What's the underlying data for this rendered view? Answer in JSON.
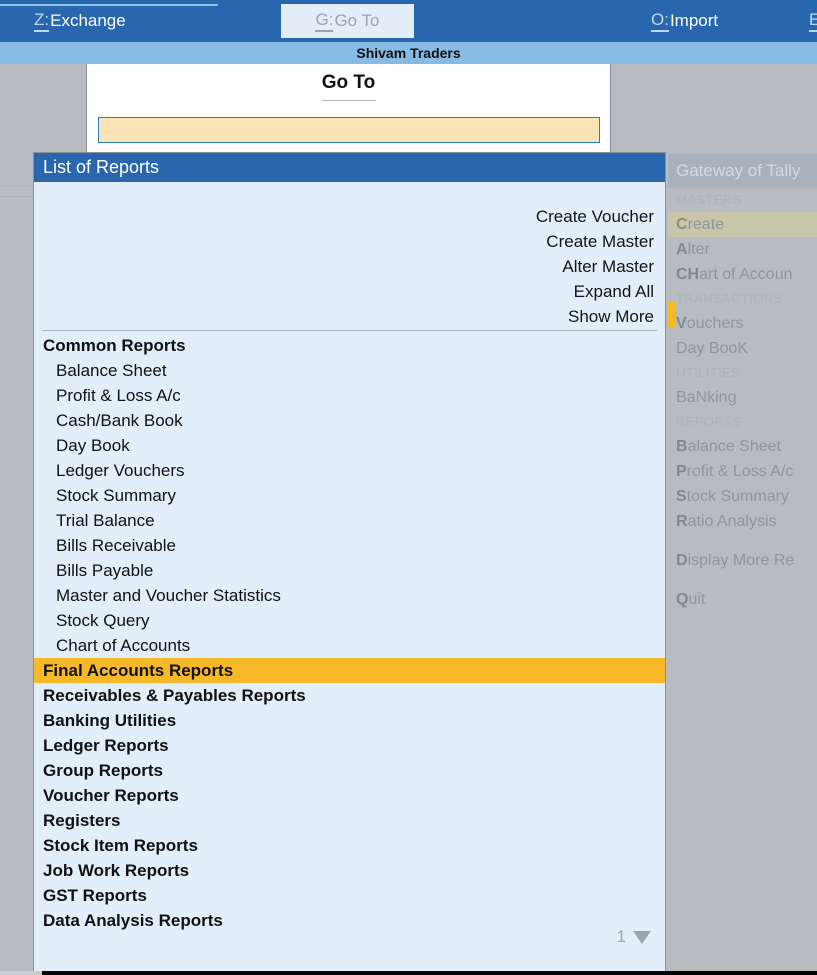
{
  "topbar": {
    "buttons": [
      {
        "hotkey": "Z:",
        "label": "Exchange",
        "state": "normal"
      },
      {
        "hotkey": "G:",
        "label": "Go To",
        "state": "active"
      },
      {
        "hotkey": "O:",
        "label": "Import",
        "state": "normal"
      },
      {
        "hotkey": "E:",
        "label": "",
        "state": "normal"
      }
    ]
  },
  "company": {
    "name": "Shivam Traders"
  },
  "goto_dialog": {
    "title": "Go To",
    "input_value": "",
    "input_placeholder": ""
  },
  "gateway": {
    "title": "Gateway of Tally",
    "sections": [
      {
        "heading": "MASTERS",
        "items": [
          {
            "hotkey": "C",
            "rest": "reate",
            "selected": true
          },
          {
            "hotkey": "A",
            "rest": "lter",
            "selected": false
          },
          {
            "hotkey": "CH",
            "rest": "art of Accoun",
            "selected": false
          }
        ]
      },
      {
        "heading": "TRANSACTIONS",
        "items": [
          {
            "hotkey": "V",
            "rest": "ouchers",
            "selected": false
          },
          {
            "hotkey": "",
            "rest": "Day BooK",
            "selected": false
          }
        ]
      },
      {
        "heading": "UTILITIES",
        "items": [
          {
            "hotkey": "",
            "rest": "BaNking",
            "selected": false
          }
        ]
      },
      {
        "heading": "REPORTS",
        "items": [
          {
            "hotkey": "B",
            "rest": "alance Sheet",
            "selected": false
          },
          {
            "hotkey": "P",
            "rest": "rofit & Loss A/c",
            "selected": false
          },
          {
            "hotkey": "S",
            "rest": "tock Summary",
            "selected": false
          },
          {
            "hotkey": "R",
            "rest": "atio Analysis",
            "selected": false
          }
        ]
      },
      {
        "heading": "",
        "items": [
          {
            "hotkey": "D",
            "rest": "isplay More Re",
            "selected": false
          }
        ]
      },
      {
        "heading": "",
        "items": [
          {
            "hotkey": "Q",
            "rest": "uit",
            "selected": false
          }
        ]
      }
    ]
  },
  "list_of_reports": {
    "title": "List of Reports",
    "actions": [
      "Create Voucher",
      "Create Master",
      "Alter Master",
      "Expand All",
      "Show More"
    ],
    "rows": [
      {
        "label": "Common Reports",
        "type": "group",
        "selected": false
      },
      {
        "label": "Balance Sheet",
        "type": "child",
        "selected": false
      },
      {
        "label": "Profit & Loss A/c",
        "type": "child",
        "selected": false
      },
      {
        "label": "Cash/Bank Book",
        "type": "child",
        "selected": false
      },
      {
        "label": "Day Book",
        "type": "child",
        "selected": false
      },
      {
        "label": "Ledger Vouchers",
        "type": "child",
        "selected": false
      },
      {
        "label": "Stock Summary",
        "type": "child",
        "selected": false
      },
      {
        "label": "Trial Balance",
        "type": "child",
        "selected": false
      },
      {
        "label": "Bills Receivable",
        "type": "child",
        "selected": false
      },
      {
        "label": "Bills Payable",
        "type": "child",
        "selected": false
      },
      {
        "label": "Master and Voucher Statistics",
        "type": "child",
        "selected": false
      },
      {
        "label": "Stock Query",
        "type": "child",
        "selected": false
      },
      {
        "label": "Chart of Accounts",
        "type": "child",
        "selected": false
      },
      {
        "label": "Final Accounts Reports",
        "type": "group",
        "selected": true
      },
      {
        "label": "Receivables & Payables Reports",
        "type": "group",
        "selected": false
      },
      {
        "label": "Banking Utilities",
        "type": "group",
        "selected": false
      },
      {
        "label": "Ledger Reports",
        "type": "group",
        "selected": false
      },
      {
        "label": "Group Reports",
        "type": "group",
        "selected": false
      },
      {
        "label": "Voucher Reports",
        "type": "group",
        "selected": false
      },
      {
        "label": "Registers",
        "type": "group",
        "selected": false
      },
      {
        "label": "Stock Item Reports",
        "type": "group",
        "selected": false
      },
      {
        "label": "Job Work Reports",
        "type": "group",
        "selected": false
      },
      {
        "label": "GST Reports",
        "type": "group",
        "selected": false
      },
      {
        "label": "Data Analysis Reports",
        "type": "group",
        "selected": false
      }
    ],
    "page_number": "1",
    "page_caret": "chevron-down-icon"
  },
  "colors": {
    "header_blue": "#2866ae",
    "company_band": "#87bbe4",
    "panel_bg": "#e2eef9",
    "highlight": "#f7b928",
    "input_bg": "#fae3b4",
    "desktop_grey": "#b8bcc0"
  }
}
